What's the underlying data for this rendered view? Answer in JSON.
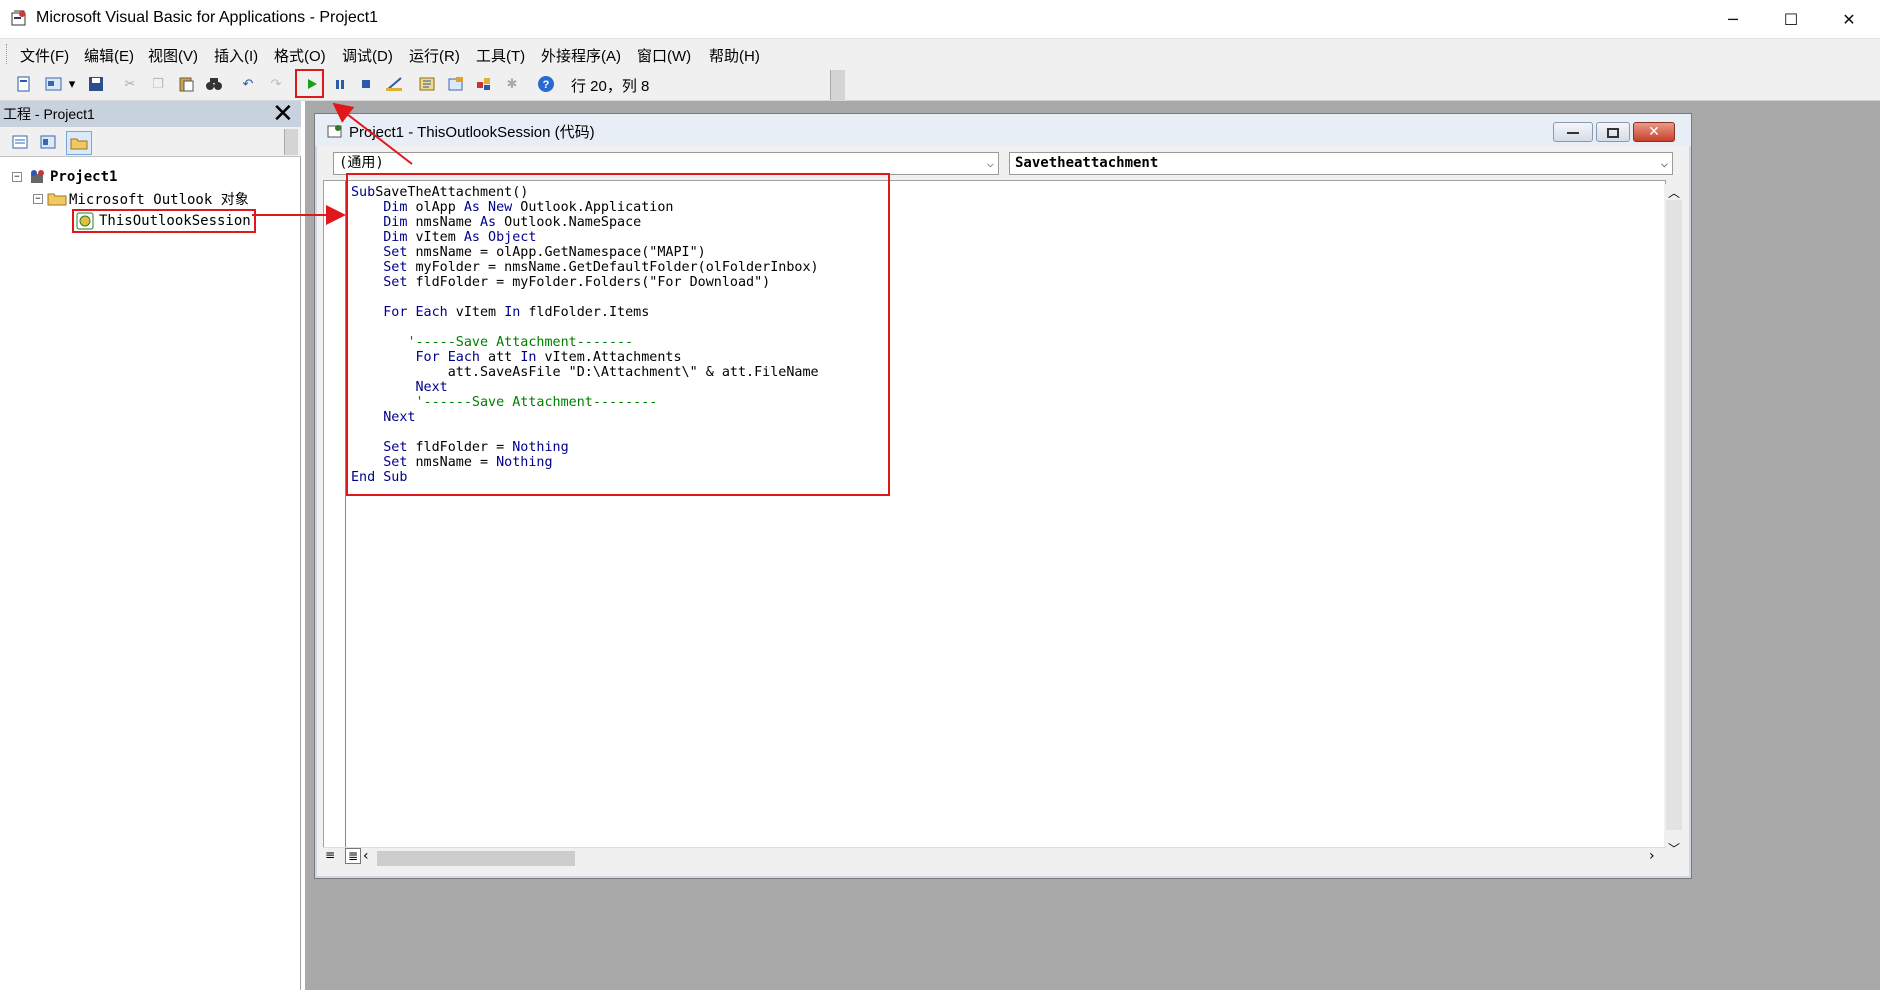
{
  "titlebar": {
    "title": "Microsoft Visual Basic for Applications - Project1",
    "app_icon": "vba-app-icon"
  },
  "window_controls": {
    "minimize": "─",
    "maximize": "☐",
    "close": "✕"
  },
  "menu": [
    "文件(F)",
    "编辑(E)",
    "视图(V)",
    "插入(I)",
    "格式(O)",
    "调试(D)",
    "运行(R)",
    "工具(T)",
    "外接程序(A)",
    "窗口(W)",
    "帮助(H)"
  ],
  "toolbar": {
    "position": "行 20，列 8",
    "run_icon": "run-icon"
  },
  "project_pane": {
    "title": "工程 - Project1",
    "close": "✕"
  },
  "tree": {
    "root": "Project1",
    "folder": "Microsoft Outlook 对象",
    "item": "ThisOutlookSession"
  },
  "code_window": {
    "title": "Project1 - ThisOutlookSession (代码)",
    "object_select": "(通用)",
    "proc_select": "Savetheattachment"
  },
  "code": [
    {
      "parts": [
        [
          "kw",
          "Sub"
        ],
        [
          "",
          "SaveTheAttachment()"
        ]
      ]
    },
    {
      "parts": [
        [
          "",
          "    "
        ],
        [
          "kw",
          "Dim"
        ],
        [
          "",
          " olApp "
        ],
        [
          "kw",
          "As New"
        ],
        [
          "",
          " Outlook.Application"
        ]
      ]
    },
    {
      "parts": [
        [
          "",
          "    "
        ],
        [
          "kw",
          "Dim"
        ],
        [
          "",
          " nmsName "
        ],
        [
          "kw",
          "As"
        ],
        [
          "",
          " Outlook.NameSpace"
        ]
      ]
    },
    {
      "parts": [
        [
          "",
          "    "
        ],
        [
          "kw",
          "Dim"
        ],
        [
          "",
          " vItem "
        ],
        [
          "kw",
          "As Object"
        ]
      ]
    },
    {
      "parts": [
        [
          "",
          "    "
        ],
        [
          "kw",
          "Set"
        ],
        [
          "",
          " nmsName = olApp.GetNamespace(\"MAPI\")"
        ]
      ]
    },
    {
      "parts": [
        [
          "",
          "    "
        ],
        [
          "kw",
          "Set"
        ],
        [
          "",
          " myFolder = nmsName.GetDefaultFolder(olFolderInbox)"
        ]
      ]
    },
    {
      "parts": [
        [
          "",
          "    "
        ],
        [
          "kw",
          "Set"
        ],
        [
          "",
          " fldFolder = myFolder.Folders(\"For Download\")"
        ]
      ]
    },
    {
      "parts": [
        [
          "",
          ""
        ]
      ]
    },
    {
      "parts": [
        [
          "",
          "    "
        ],
        [
          "kw",
          "For Each"
        ],
        [
          "",
          " vItem "
        ],
        [
          "kw",
          "In"
        ],
        [
          "",
          " fldFolder.Items"
        ]
      ]
    },
    {
      "parts": [
        [
          "",
          ""
        ]
      ]
    },
    {
      "parts": [
        [
          "",
          "       "
        ],
        [
          "cm",
          "'-----Save Attachment-------"
        ]
      ]
    },
    {
      "parts": [
        [
          "",
          "        "
        ],
        [
          "kw",
          "For Each"
        ],
        [
          "",
          " att "
        ],
        [
          "kw",
          "In"
        ],
        [
          "",
          " vItem.Attachments"
        ]
      ]
    },
    {
      "parts": [
        [
          "",
          "            att.SaveAsFile \"D:\\Attachment\\\" & att.FileName"
        ]
      ]
    },
    {
      "parts": [
        [
          "",
          "        "
        ],
        [
          "kw",
          "Next"
        ]
      ]
    },
    {
      "parts": [
        [
          "",
          "        "
        ],
        [
          "cm",
          "'------Save Attachment--------"
        ]
      ]
    },
    {
      "parts": [
        [
          "",
          "    "
        ],
        [
          "kw",
          "Next"
        ]
      ]
    },
    {
      "parts": [
        [
          "",
          ""
        ]
      ]
    },
    {
      "parts": [
        [
          "",
          "    "
        ],
        [
          "kw",
          "Set"
        ],
        [
          "",
          " fldFolder = "
        ],
        [
          "kw",
          "Nothing"
        ]
      ]
    },
    {
      "parts": [
        [
          "",
          "    "
        ],
        [
          "kw",
          "Set"
        ],
        [
          "",
          " nmsName = "
        ],
        [
          "kw",
          "Nothing"
        ]
      ]
    },
    {
      "parts": [
        [
          "kw",
          "End Sub"
        ]
      ]
    }
  ],
  "colors": {
    "keyword": "#00008b",
    "comment": "#008000",
    "highlight": "#e0181c",
    "workspace": "#a9a9a9"
  }
}
